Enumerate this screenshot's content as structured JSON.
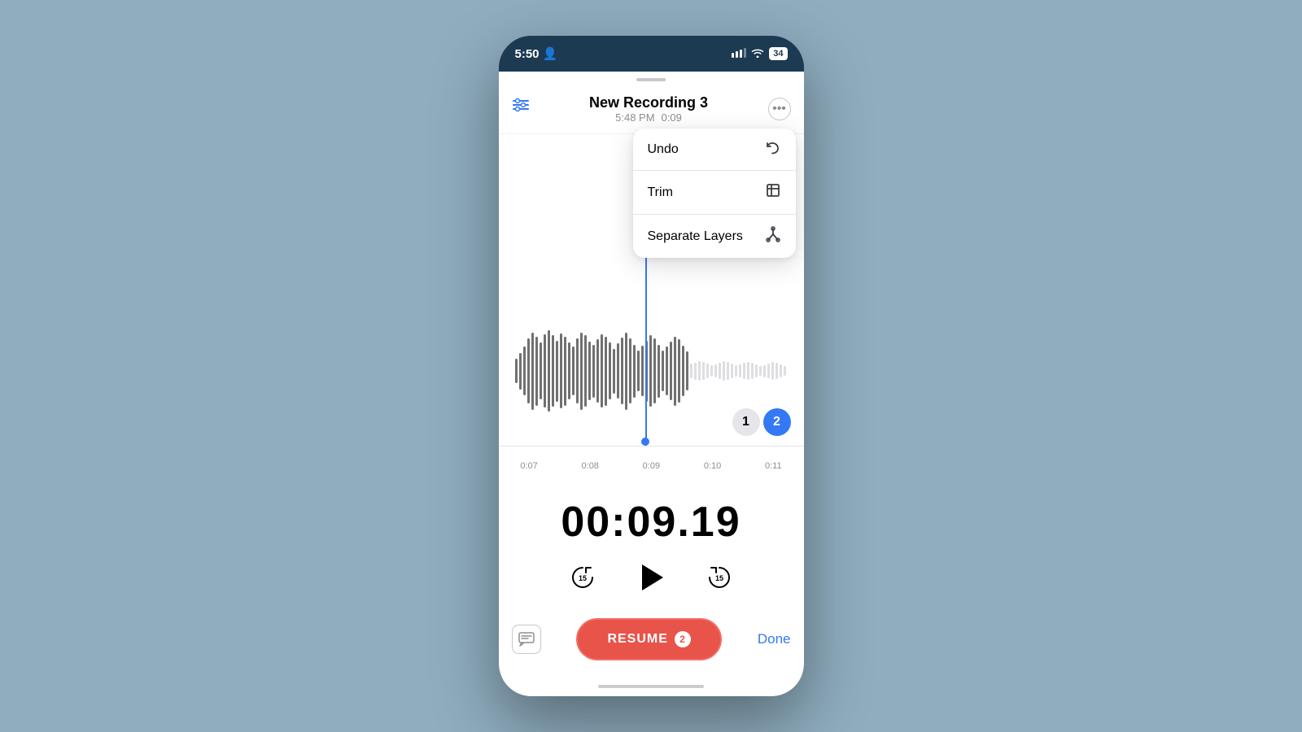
{
  "statusBar": {
    "time": "5:50",
    "userIcon": "👤",
    "batteryLevel": "34"
  },
  "header": {
    "title": "New Recording 3",
    "time": "5:48 PM",
    "duration": "0:09",
    "moreLabel": "•••"
  },
  "dropdown": {
    "items": [
      {
        "label": "Undo",
        "icon": "↩"
      },
      {
        "label": "Trim",
        "icon": "⌧"
      },
      {
        "label": "Separate Layers",
        "icon": "⑂"
      }
    ]
  },
  "timeline": {
    "marks": [
      "0:07",
      "0:08",
      "0:09",
      "0:10",
      "0:11"
    ]
  },
  "tracks": {
    "inactive": "1",
    "active": "2"
  },
  "timeDisplay": "00:09.19",
  "playback": {
    "rewindLabel": "15",
    "forwardLabel": "15"
  },
  "bottomBar": {
    "resumeLabel": "RESUME",
    "resumeBadge": "2",
    "doneLabel": "Done"
  }
}
